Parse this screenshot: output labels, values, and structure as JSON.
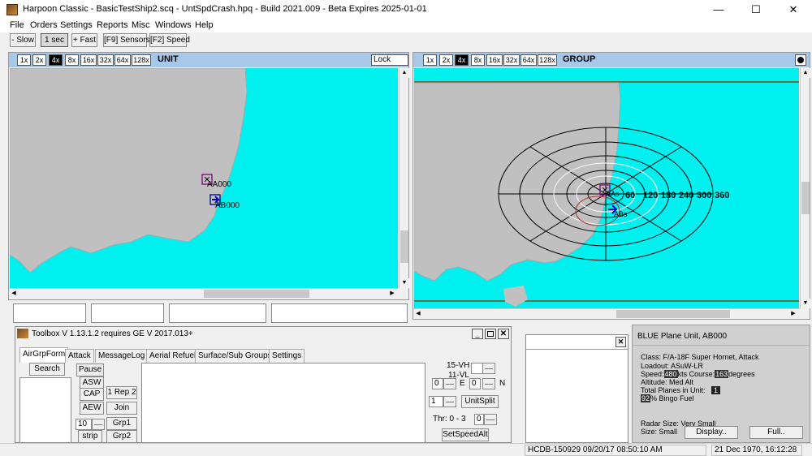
{
  "window": {
    "title": "Harpoon Classic  -  BasicTestShip2.scq  -  UntSpdCrash.hpq  -  Build 2021.009  -  Beta Expires 2025-01-01",
    "minimize": "—",
    "maximize": "☐",
    "close": "✕"
  },
  "menu": [
    "File",
    "Orders",
    "Settings",
    "Reports",
    "Misc",
    "Windows",
    "Help"
  ],
  "toolbar": {
    "slow": "- Slow",
    "one_sec": "1 sec",
    "fast": "+ Fast",
    "sensors": "[F9] Sensors",
    "speed": "[F2] Speed"
  },
  "unit_pane": {
    "zoom": [
      "1x",
      "2x",
      "4x",
      "8x",
      "16x",
      "32x",
      "64x",
      "128x"
    ],
    "active_zoom": "4x",
    "label": "UNIT",
    "lock": "Lock",
    "units": [
      "AA000",
      "AB000"
    ]
  },
  "group_pane": {
    "zoom": [
      "1x",
      "2x",
      "4x",
      "8x",
      "16x",
      "32x",
      "64x",
      "128x"
    ],
    "active_zoom": "4x",
    "label": "GROUP",
    "range_labels": [
      "60",
      "120",
      "180",
      "240",
      "300",
      "360"
    ],
    "units": [
      "AAs",
      "ABs"
    ]
  },
  "toolbox": {
    "title": "Toolbox V 1.13.1.2 requires GE V 2017.013+",
    "tabs": [
      "AirGrpForm",
      "Attack",
      "MessageLog",
      "Aerial Refuel",
      "Surface/Sub Groups",
      "Settings"
    ],
    "active_tab": "AirGrpForm",
    "buttons": {
      "search": "Search",
      "pause": "Pause",
      "asw": "ASW",
      "cap": "CAP",
      "aew": "AEW",
      "rep2": "1 Rep 2",
      "join": "Join",
      "grp1": "Grp1",
      "grp2": "Grp2",
      "strip": "strip",
      "unitsplit": "UnitSplit",
      "setspeedalt": "SetSpeedAlt"
    },
    "values": {
      "num10": "10",
      "alt_top": "15-VH",
      "alt_bottom": "11-VL",
      "e_value": "0",
      "e_label": "E",
      "n_value": "0",
      "n_label": "N",
      "split_value": "1",
      "thr_label": "Thr: 0 - 3",
      "thr_value": "0"
    }
  },
  "unit_info": {
    "header": "BLUE Plane Unit, AB000",
    "class_line": "Class: F/A-18F Super Hornet, Attack",
    "loadout": "Loadout: ASuW-LR",
    "speed_label": "Speed:",
    "speed_value": "480",
    "speed_unit": "kts",
    "course_label": "Course:",
    "course_value": "163",
    "course_unit": "degrees",
    "altitude": "Altitude:   Med Alt",
    "total_planes_label": "Total Planes in Unit:",
    "total_planes": "1",
    "fuel_value": "92",
    "fuel_label": "% Bingo Fuel",
    "radar": "Radar Size: Very Small",
    "size": "Size: Small",
    "display_btn": "Display..",
    "full_btn": "Full.."
  },
  "small_panel": {
    "close": "✕"
  },
  "status": {
    "build": "HCDB-150929 09/20/17 08:50:10 AM",
    "datetime": "21 Dec 1970, 16:12:28"
  },
  "colors": {
    "sea": "#00f0f0",
    "land": "#c0c0c0",
    "header": "#a8c8ea",
    "range_rings": "#000000",
    "track": "#8b4513",
    "unit_marker": "#800080",
    "friendly": "#0000cc"
  }
}
